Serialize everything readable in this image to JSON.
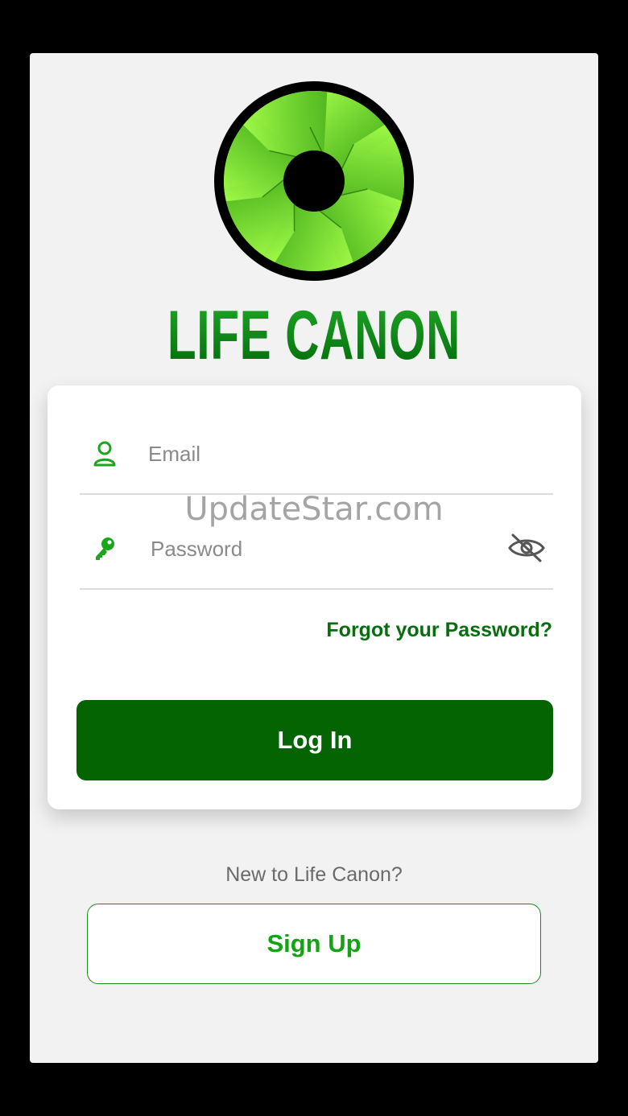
{
  "app": {
    "brand_name": "LIFE CANON",
    "logo_icon": "camera-aperture-icon"
  },
  "login_form": {
    "email": {
      "icon": "user-icon",
      "placeholder": "Email",
      "value": ""
    },
    "password": {
      "icon": "key-icon",
      "placeholder": "Password",
      "value": "",
      "toggle_icon": "eye-off-icon"
    },
    "forgot_password_label": "Forgot your Password?",
    "login_label": "Log In"
  },
  "signup": {
    "prompt": "New to Life Canon?",
    "button_label": "Sign Up"
  },
  "watermark": "UpdateStar.com",
  "colors": {
    "brand_green": "#036401",
    "accent_green": "#13a313",
    "icon_green": "#1aa51a",
    "background": "#f2f2f2"
  }
}
